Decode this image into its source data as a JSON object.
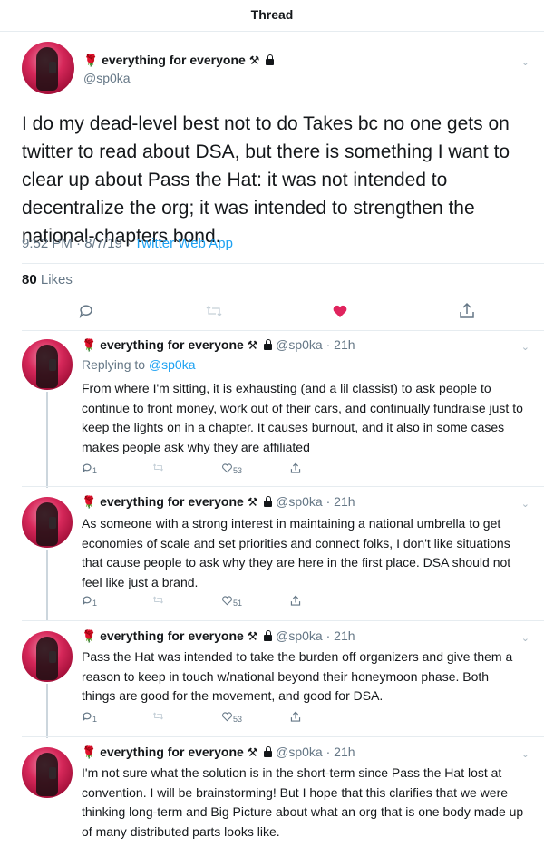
{
  "header": {
    "title": "Thread"
  },
  "main_tweet": {
    "display_name": "everything for everyone",
    "handle": "@sp0ka",
    "text": "I do my dead-level best not to do Takes bc no one gets on twitter to read about DSA, but there is something I want to clear up about Pass the Hat: it was not intended to decentralize the org; it was intended to strengthen the national-chapters bond.",
    "time": "9:52 PM · 8/7/19 · ",
    "app": "Twitter Web App",
    "likes_count": "80",
    "likes_label": "Likes"
  },
  "replies": [
    {
      "display_name": "everything for everyone",
      "handle": "@sp0ka · 21h",
      "replying_prefix": "Replying to ",
      "replying_to": "@sp0ka",
      "text": "From where I'm sitting, it is exhausting (and a lil classist) to ask people to continue to front money, work out of their cars, and continually fundraise just to keep the lights on in a chapter. It causes burnout, and it also in some cases makes people ask why they are affiliated",
      "reply_count": "1",
      "like_count": "53"
    },
    {
      "display_name": "everything for everyone",
      "handle": "@sp0ka · 21h",
      "text": "As someone with a strong interest in maintaining a national umbrella to get economies of scale and set priorities and connect folks, I don't like situations that cause people to ask why they are here in the first place. DSA should not feel like just a brand.",
      "reply_count": "1",
      "like_count": "51"
    },
    {
      "display_name": "everything for everyone",
      "handle": "@sp0ka · 21h",
      "text": "Pass the Hat was intended to take the burden off organizers and give them a reason to keep in touch w/national beyond their honeymoon phase. Both things are good for the movement, and good for DSA.",
      "reply_count": "1",
      "like_count": "53"
    },
    {
      "display_name": "everything for everyone",
      "handle": "@sp0ka · 21h",
      "text": "I'm not sure what the solution is in the short-term since Pass the Hat lost at convention. I will be brainstorming! But I hope that this clarifies that we were thinking long-term and Big Picture about what an org that is one body made up of many distributed parts looks like."
    }
  ],
  "colors": {
    "link": "#1da1f2",
    "like": "#e0245e",
    "muted": "#657786"
  }
}
